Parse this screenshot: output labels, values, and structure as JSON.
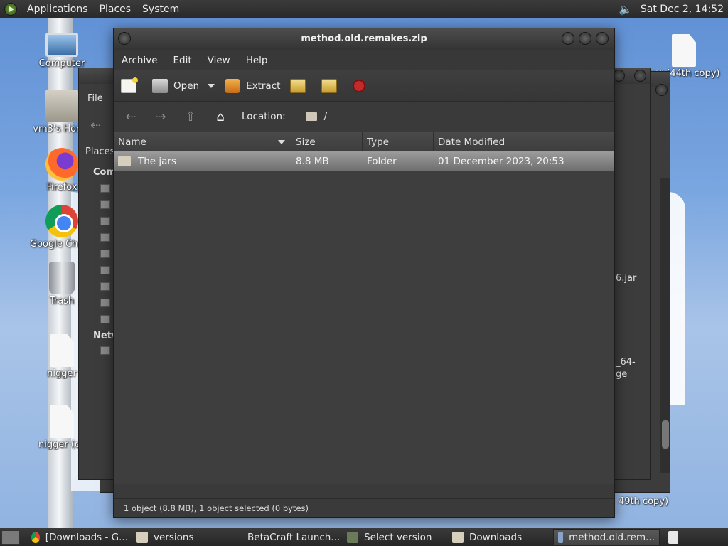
{
  "top_panel": {
    "menus": [
      "Applications",
      "Places",
      "System"
    ],
    "clock": "Sat Dec  2, 14:52"
  },
  "desktop": {
    "icons": [
      {
        "label": "Computer"
      },
      {
        "label": "vm3's Home"
      },
      {
        "label": "Firefox"
      },
      {
        "label": "Google Chrome"
      },
      {
        "label": "Trash"
      },
      {
        "label": "nigger"
      },
      {
        "label": "nigger (co"
      }
    ],
    "right_icon_label": "ger (44th copy)",
    "right_bottom_label": "49th copy)"
  },
  "bg_window": {
    "menu_file": "File",
    "places": "Places",
    "section_computer": "Com",
    "section_network": "Netw",
    "file_a": "6.jar",
    "file_b1": "_64-",
    "file_b2": "ge"
  },
  "window": {
    "title": "method.old.remakes.zip",
    "menu": [
      "Archive",
      "Edit",
      "View",
      "Help"
    ],
    "toolbar": {
      "open_label": "Open",
      "extract_label": "Extract"
    },
    "location_label": "Location:",
    "location_path": "/",
    "columns": [
      "Name",
      "Size",
      "Type",
      "Date Modified"
    ],
    "rows": [
      {
        "name": "The jars",
        "size": "8.8 MB",
        "type": "Folder",
        "date": "01 December 2023, 20:53"
      }
    ],
    "status": "1 object (8.8 MB), 1 object selected (0 bytes)"
  },
  "taskbar": {
    "tasks": [
      {
        "label": "[Downloads - G..."
      },
      {
        "label": "versions"
      },
      {
        "label": "BetaCraft Launch..."
      },
      {
        "label": "Select version"
      },
      {
        "label": "Downloads"
      },
      {
        "label": "method.old.rem..."
      }
    ]
  }
}
